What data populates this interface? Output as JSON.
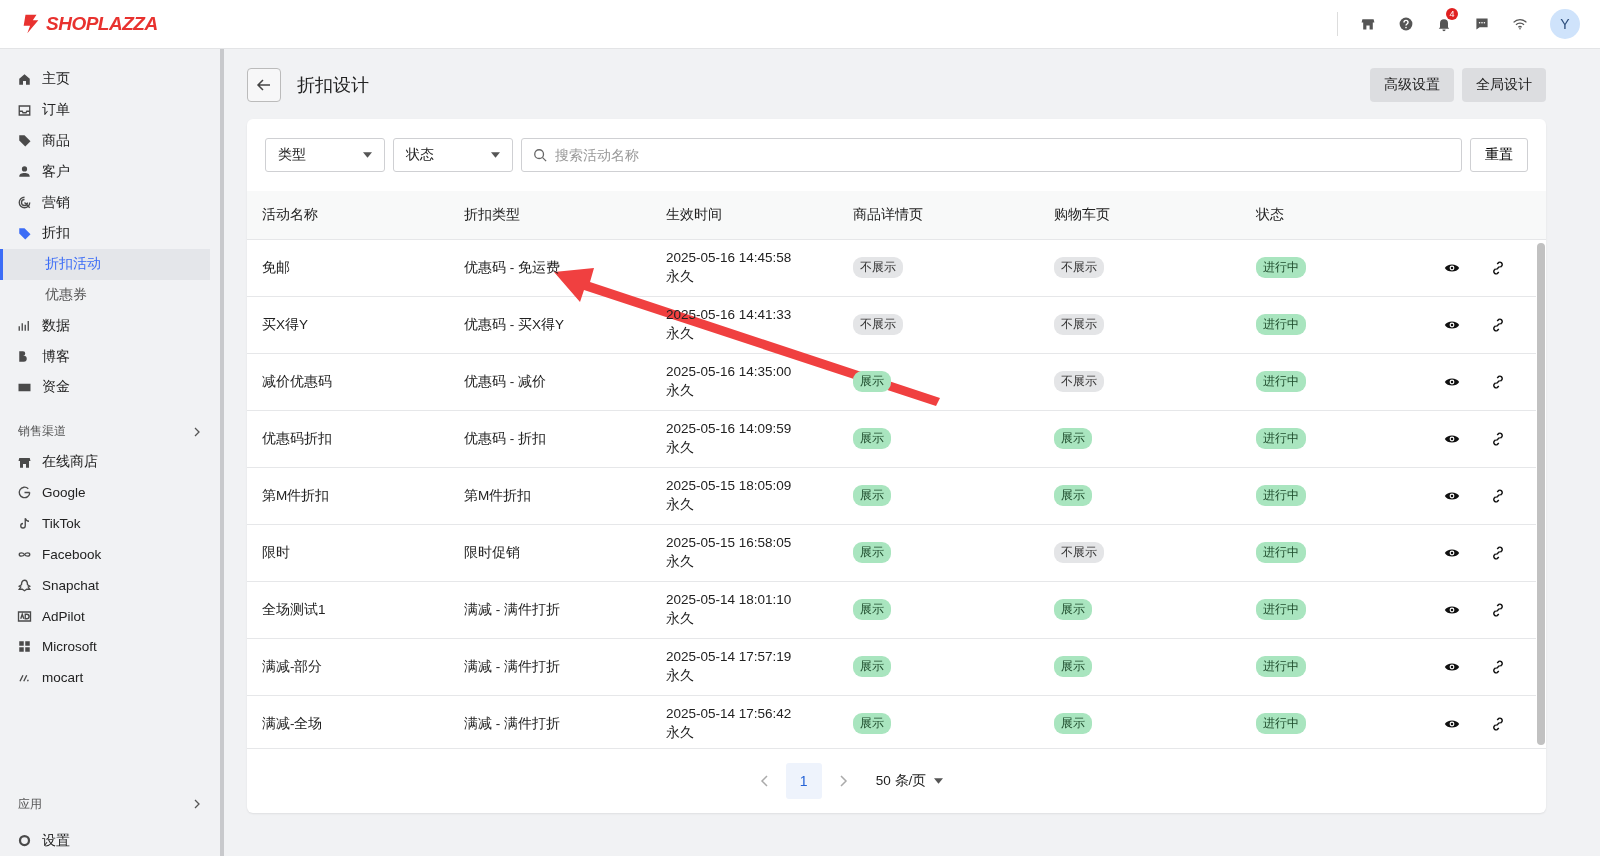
{
  "brand": {
    "name": "SHOPLAZZA"
  },
  "header": {
    "notification_count": "4",
    "avatar": "Y"
  },
  "sidebar": {
    "items": [
      {
        "label": "主页",
        "selected": false
      },
      {
        "label": "订单",
        "selected": false
      },
      {
        "label": "商品",
        "selected": false
      },
      {
        "label": "客户",
        "selected": false
      },
      {
        "label": "营销",
        "selected": false
      },
      {
        "label": "折扣",
        "selected": false,
        "children": [
          {
            "label": "折扣活动",
            "selected": true
          },
          {
            "label": "优惠券",
            "selected": false
          }
        ]
      },
      {
        "label": "数据",
        "selected": false
      },
      {
        "label": "博客",
        "selected": false
      },
      {
        "label": "资金",
        "selected": false
      }
    ],
    "channels_heading": "销售渠道",
    "channels": [
      {
        "label": "在线商店"
      },
      {
        "label": "Google"
      },
      {
        "label": "TikTok"
      },
      {
        "label": "Facebook"
      },
      {
        "label": "Snapchat"
      },
      {
        "label": "AdPilot"
      },
      {
        "label": "Microsoft"
      },
      {
        "label": "mocart"
      }
    ],
    "apps_heading": "应用",
    "settings": "设置"
  },
  "page": {
    "title": "折扣设计",
    "buttons": [
      "高级设置",
      "全局设计"
    ]
  },
  "filters": {
    "type": "类型",
    "status": "状态",
    "search_placeholder": "搜索活动名称",
    "reset": "重置"
  },
  "table": {
    "columns": [
      "活动名称",
      "折扣类型",
      "生效时间",
      "商品详情页",
      "购物车页",
      "状态"
    ],
    "rows": [
      {
        "name": "免邮",
        "type": "优惠码 - 免运费",
        "start": "2025-05-16 14:45:58",
        "end": "永久",
        "detail": {
          "label": "不展示",
          "shown": false
        },
        "cart": {
          "label": "不展示",
          "shown": false
        },
        "status": "进行中"
      },
      {
        "name": "买X得Y",
        "type": "优惠码 - 买X得Y",
        "start": "2025-05-16 14:41:33",
        "end": "永久",
        "detail": {
          "label": "不展示",
          "shown": false
        },
        "cart": {
          "label": "不展示",
          "shown": false
        },
        "status": "进行中"
      },
      {
        "name": "减价优惠码",
        "type": "优惠码 - 减价",
        "start": "2025-05-16 14:35:00",
        "end": "永久",
        "detail": {
          "label": "展示",
          "shown": true
        },
        "cart": {
          "label": "不展示",
          "shown": false
        },
        "status": "进行中"
      },
      {
        "name": "优惠码折扣",
        "type": "优惠码 - 折扣",
        "start": "2025-05-16 14:09:59",
        "end": "永久",
        "detail": {
          "label": "展示",
          "shown": true
        },
        "cart": {
          "label": "展示",
          "shown": true
        },
        "status": "进行中"
      },
      {
        "name": "第M件折扣",
        "type": "第M件折扣",
        "start": "2025-05-15 18:05:09",
        "end": "永久",
        "detail": {
          "label": "展示",
          "shown": true
        },
        "cart": {
          "label": "展示",
          "shown": true
        },
        "status": "进行中"
      },
      {
        "name": "限时",
        "type": "限时促销",
        "start": "2025-05-15 16:58:05",
        "end": "永久",
        "detail": {
          "label": "展示",
          "shown": true
        },
        "cart": {
          "label": "不展示",
          "shown": false
        },
        "status": "进行中"
      },
      {
        "name": "全场测试1",
        "type": "满减 - 满件打折",
        "start": "2025-05-14 18:01:10",
        "end": "永久",
        "detail": {
          "label": "展示",
          "shown": true
        },
        "cart": {
          "label": "展示",
          "shown": true
        },
        "status": "进行中"
      },
      {
        "name": "满减-部分",
        "type": "满减 - 满件打折",
        "start": "2025-05-14 17:57:19",
        "end": "永久",
        "detail": {
          "label": "展示",
          "shown": true
        },
        "cart": {
          "label": "展示",
          "shown": true
        },
        "status": "进行中"
      },
      {
        "name": "满减-全场",
        "type": "满减 - 满件打折",
        "start": "2025-05-14 17:56:42",
        "end": "永久",
        "detail": {
          "label": "展示",
          "shown": true
        },
        "cart": {
          "label": "展示",
          "shown": true
        },
        "status": "进行中"
      }
    ]
  },
  "pagination": {
    "pages": [
      {
        "label": "1",
        "selected": true
      }
    ],
    "page_size": "50 条/页"
  }
}
